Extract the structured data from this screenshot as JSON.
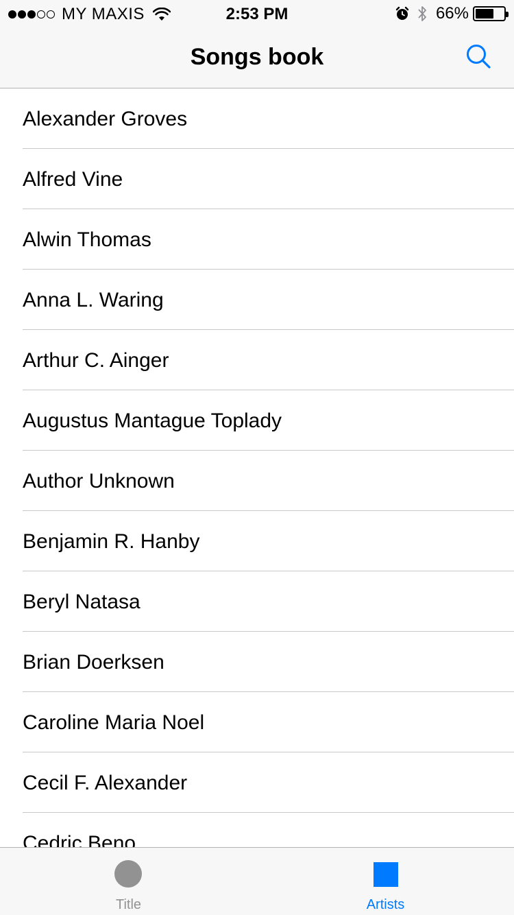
{
  "status_bar": {
    "signal_bars_filled": 3,
    "signal_bars_total": 5,
    "carrier": "MY MAXIS",
    "time": "2:53 PM",
    "battery_percent_text": "66%",
    "battery_level": 0.66,
    "icons": [
      "wifi-icon",
      "alarm-icon",
      "bluetooth-icon",
      "battery-icon"
    ]
  },
  "nav": {
    "title": "Songs book",
    "search_icon": "search-icon"
  },
  "list": {
    "items": [
      "Alexander Groves",
      "Alfred Vine",
      "Alwin Thomas",
      "Anna L. Waring",
      "Arthur C. Ainger",
      "Augustus Mantague Toplady",
      "Author Unknown",
      "Benjamin R. Hanby",
      "Beryl Natasa",
      "Brian Doerksen",
      "Caroline Maria Noel",
      "Cecil F. Alexander",
      "Cedric Beno"
    ]
  },
  "tabs": [
    {
      "label": "Title",
      "icon": "circle-icon",
      "selected": false
    },
    {
      "label": "Artists",
      "icon": "square-icon",
      "selected": true
    }
  ],
  "colors": {
    "accent": "#007aff",
    "inactive": "#929292",
    "bar_background": "#f7f7f7",
    "separator": "#c8c7cc"
  }
}
